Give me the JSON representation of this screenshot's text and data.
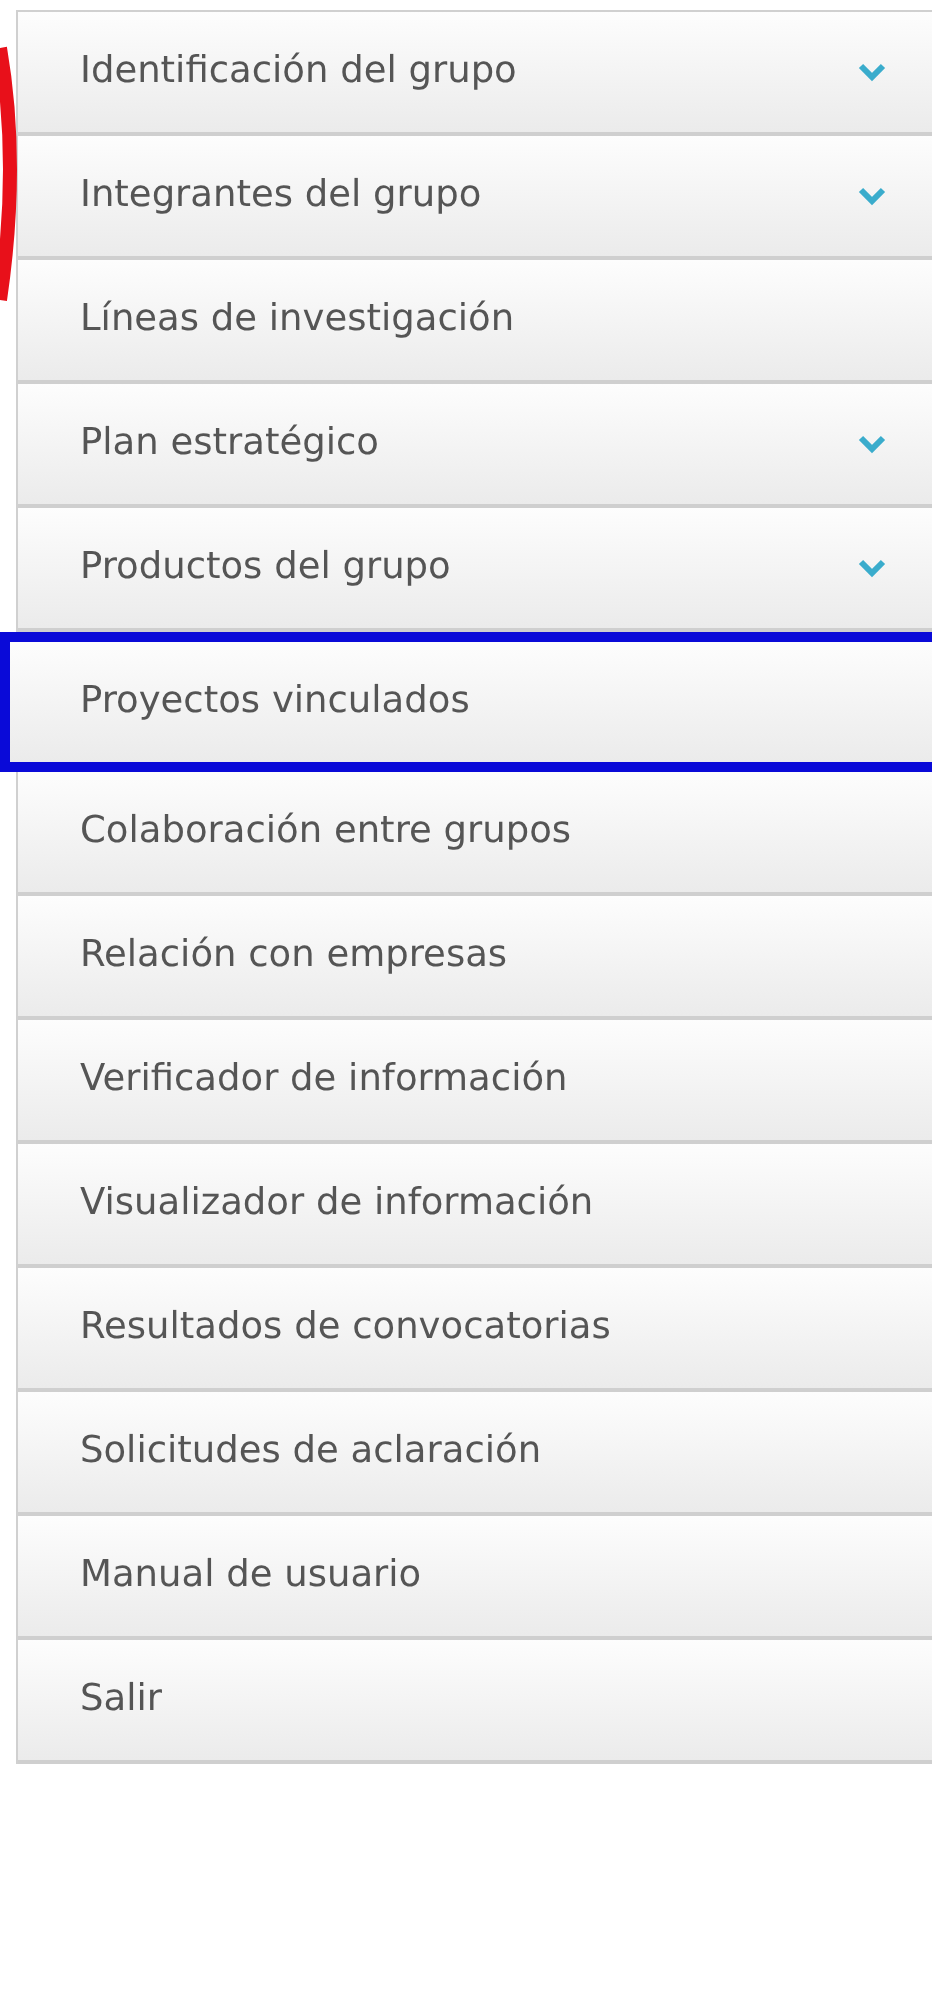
{
  "menu": {
    "items": [
      {
        "label": "Identificación del grupo",
        "expandable": true,
        "selected": false
      },
      {
        "label": "Integrantes del grupo",
        "expandable": true,
        "selected": false
      },
      {
        "label": "Líneas de investigación",
        "expandable": false,
        "selected": false
      },
      {
        "label": "Plan estratégico",
        "expandable": true,
        "selected": false
      },
      {
        "label": "Productos del grupo",
        "expandable": true,
        "selected": false
      },
      {
        "label": "Proyectos vinculados",
        "expandable": false,
        "selected": true
      },
      {
        "label": "Colaboración entre grupos",
        "expandable": false,
        "selected": false
      },
      {
        "label": "Relación con empresas",
        "expandable": false,
        "selected": false
      },
      {
        "label": "Verificador de información",
        "expandable": false,
        "selected": false
      },
      {
        "label": "Visualizador de información",
        "expandable": false,
        "selected": false
      },
      {
        "label": "Resultados de convocatorias",
        "expandable": false,
        "selected": false
      },
      {
        "label": "Solicitudes de aclaración",
        "expandable": false,
        "selected": false
      },
      {
        "label": "Manual de usuario",
        "expandable": false,
        "selected": false
      },
      {
        "label": "Salir",
        "expandable": false,
        "selected": false
      }
    ]
  }
}
